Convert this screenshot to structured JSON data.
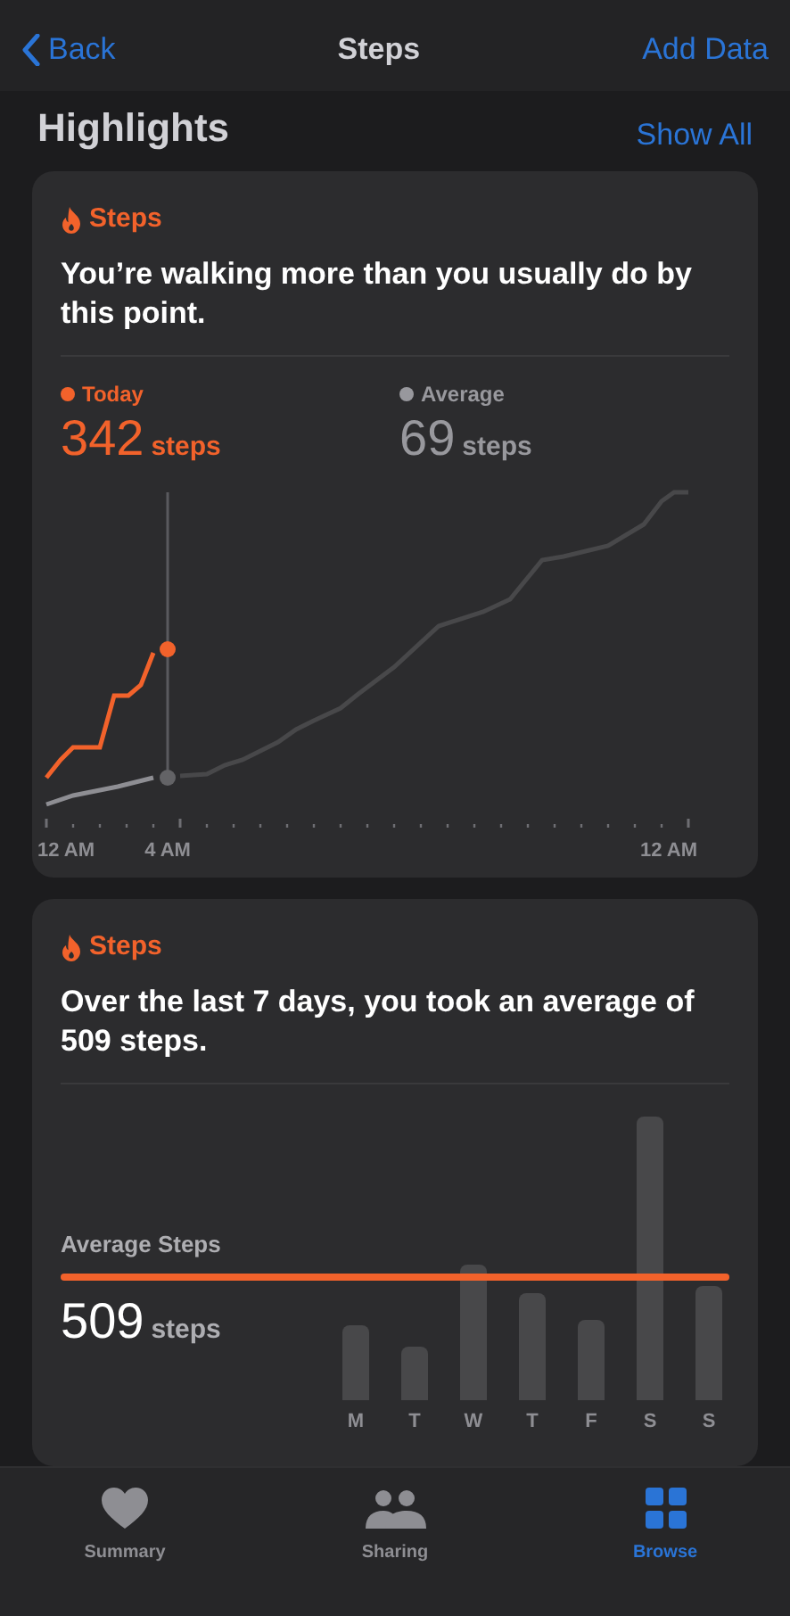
{
  "nav": {
    "back": "Back",
    "title": "Steps",
    "action": "Add Data"
  },
  "section": {
    "title": "Highlights",
    "link": "Show All"
  },
  "cards": [
    {
      "kind": "line",
      "category": "Steps",
      "message": "You’re walking more than you usually do by this point.",
      "today": {
        "label": "Today",
        "value": "342",
        "unit": "steps"
      },
      "average": {
        "label": "Average",
        "value": "69",
        "unit": "steps"
      },
      "axis": [
        "12 AM",
        "4 AM",
        "12 AM"
      ]
    },
    {
      "kind": "bar",
      "category": "Steps",
      "message": "Over the last 7 days, you took an average of 509 steps.",
      "average_label": "Average Steps",
      "value": "509",
      "unit": "steps",
      "days": [
        "M",
        "T",
        "W",
        "T",
        "F",
        "S",
        "S"
      ]
    }
  ],
  "tabs": [
    {
      "kind": "heart",
      "label": "Summary",
      "selected": false
    },
    {
      "kind": "people",
      "label": "Sharing",
      "selected": false
    },
    {
      "kind": "grid",
      "label": "Browse",
      "selected": true
    }
  ]
}
